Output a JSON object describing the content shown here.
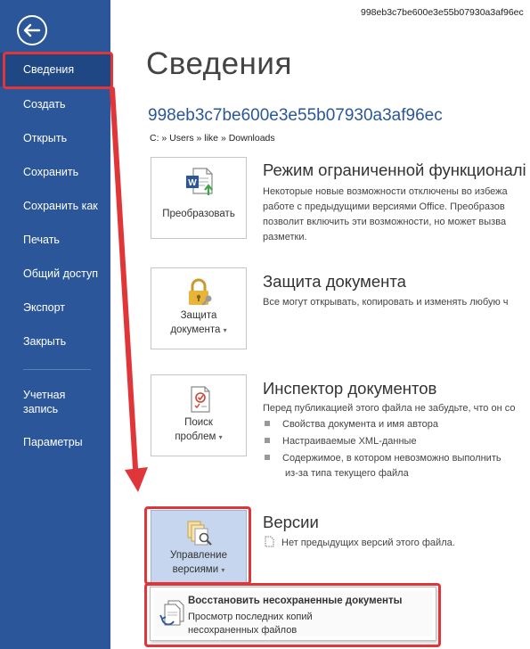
{
  "window": {
    "filename": "998eb3c7be600e3e55b07930a3af96ec"
  },
  "sidebar": {
    "back_icon": "back-arrow-icon",
    "items": [
      {
        "label": "Сведения"
      },
      {
        "label": "Создать"
      },
      {
        "label": "Открыть"
      },
      {
        "label": "Сохранить"
      },
      {
        "label": "Сохранить как"
      },
      {
        "label": "Печать"
      },
      {
        "label": "Общий доступ"
      },
      {
        "label": "Экспорт"
      },
      {
        "label": "Закрыть"
      },
      {
        "label_line1": "Учетная",
        "label_line2": "запись"
      },
      {
        "label": "Параметры"
      }
    ]
  },
  "main": {
    "title": "Сведения",
    "doc_name": "998eb3c7be600e3e55b07930a3af96ec",
    "path": "C: » Users » like » Downloads",
    "sections": [
      {
        "tile_label": "Преобразовать",
        "icon": "word-convert-icon",
        "title": "Режим ограниченной функционалі",
        "desc": [
          "Некоторые новые возможности отключены во избежа",
          "работе с предыдущими версиями Office. Преобразов",
          "позволит включить эти возможности, но может вызва",
          "разметки."
        ]
      },
      {
        "tile_label_line1": "Защита",
        "tile_label_line2": "документа",
        "icon": "lock-key-icon",
        "title": "Защита документа",
        "desc": [
          "Все могут открывать, копировать и изменять любую ч"
        ]
      },
      {
        "tile_label_line1": "Поиск",
        "tile_label_line2": "проблем",
        "icon": "inspect-checklist-icon",
        "title": "Инспектор документов",
        "desc": [
          "Перед публикацией этого файла не забудьте, что он со"
        ],
        "bullets": [
          "Свойства документа и имя автора",
          "Настраиваемые XML-данные",
          "Содержимое, в котором невозможно выполнить",
          "из-за типа текущего файла"
        ]
      },
      {
        "tile_label_line1": "Управление",
        "tile_label_line2": "версиями",
        "icon": "manage-versions-icon",
        "title": "Версии",
        "desc": [
          "Нет предыдущих версий этого файла."
        ]
      }
    ],
    "caret": "▾",
    "dropdown": {
      "title": "Восстановить несохраненные документы",
      "desc_line1": "Просмотр последних копий",
      "desc_line2": "несохраненных файлов",
      "icon": "recover-documents-icon"
    }
  },
  "colors": {
    "sidebar": "#2b579a",
    "sidebar_active": "#1e4783",
    "accent_text": "#2b579a",
    "annotation": "#e0363a",
    "tile_selected": "#c5d6ee"
  }
}
